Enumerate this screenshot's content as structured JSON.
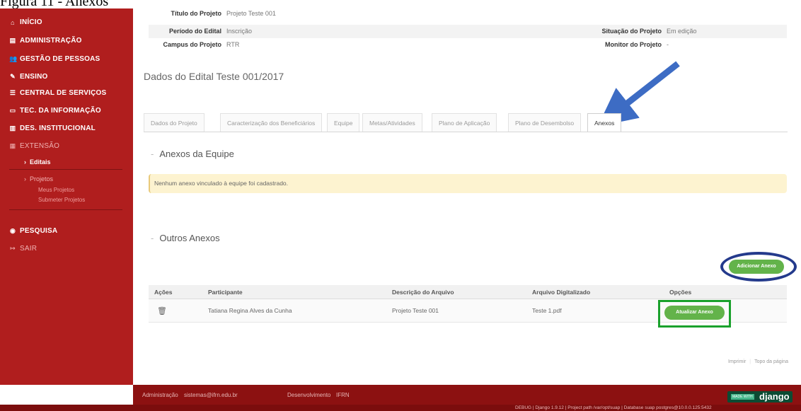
{
  "caption": "Figura 11 - Anexos",
  "sidebar": {
    "items": [
      {
        "icon": "home-icon",
        "glyph": "⌂",
        "label": "INÍCIO"
      },
      {
        "icon": "admin-icon",
        "glyph": "▤",
        "label": "ADMINISTRAÇÃO"
      },
      {
        "icon": "users-icon",
        "glyph": "👥",
        "label": "GESTÃO DE PESSOAS"
      },
      {
        "icon": "pencil-icon",
        "glyph": "✎",
        "label": "ENSINO"
      },
      {
        "icon": "list-icon",
        "glyph": "☰",
        "label": "CENTRAL DE SERVIÇOS"
      },
      {
        "icon": "monitor-icon",
        "glyph": "▭",
        "label": "TEC. DA INFORMAÇÃO"
      },
      {
        "icon": "chart-icon",
        "glyph": "▥",
        "label": "DES. INSTITUCIONAL"
      },
      {
        "icon": "extension-icon",
        "glyph": "▦",
        "label": "EXTENSÃO"
      }
    ],
    "sub": {
      "editais": "Editais",
      "projetos": "Projetos",
      "meus_projetos": "Meus Projetos",
      "submeter_projetos": "Submeter Projetos"
    },
    "pesquisa": "PESQUISA",
    "sair": "SAIR"
  },
  "info": {
    "titulo_label": "Título do Projeto",
    "titulo_value": "Projeto Teste 001",
    "periodo_label": "Período do Edital",
    "periodo_value": "Inscrição",
    "situacao_label": "Situação do Projeto",
    "situacao_value": "Em edição",
    "campus_label": "Campus do Projeto",
    "campus_value": "RTR",
    "monitor_label": "Monitor do Projeto",
    "monitor_value": "-"
  },
  "edital_title": "Dados do Edital Teste 001/2017",
  "tabs": [
    "Dados do Projeto",
    "Caracterização dos Beneficiários",
    "Equipe",
    "Metas/Atividades",
    "Plano de Aplicação",
    "Plano de Desembolso",
    "Anexos"
  ],
  "sections": {
    "equipe_title": "Anexos da Equipe",
    "equipe_alert": "Nenhum anexo vinculado à equipe foi cadastrado.",
    "outros_title": "Outros Anexos"
  },
  "buttons": {
    "adicionar": "Adicionar Anexo",
    "atualizar": "Atualizar Anexo"
  },
  "table": {
    "headers": [
      "Ações",
      "Participante",
      "Descrição do Arquivo",
      "Arquivo Digitalizado",
      "Opções"
    ],
    "rows": [
      {
        "participante": "Tatiana Regina Alves da Cunha",
        "descricao": "Projeto Teste 001",
        "arquivo": "Teste 1.pdf"
      }
    ]
  },
  "footer_links": {
    "imprimir": "Imprimir",
    "topo": "Topo da página"
  },
  "footer": {
    "admin_label": "Administração",
    "admin_email": "sistemas@ifrn.edu.br",
    "dev_label": "Desenvolvimento",
    "dev_value": "IFRN",
    "badge_small": "MADE WITH",
    "badge_big": "django",
    "debug": "DEBUG | Django 1.9.12 | Project path /var/opt/suap | Database suap postgres@10.0.0.125:5432"
  },
  "colors": {
    "sidebar": "#b01e1e",
    "button_green": "#63b34a",
    "annotation_blue": "#243a8c",
    "annotation_green": "#1aa12c"
  }
}
